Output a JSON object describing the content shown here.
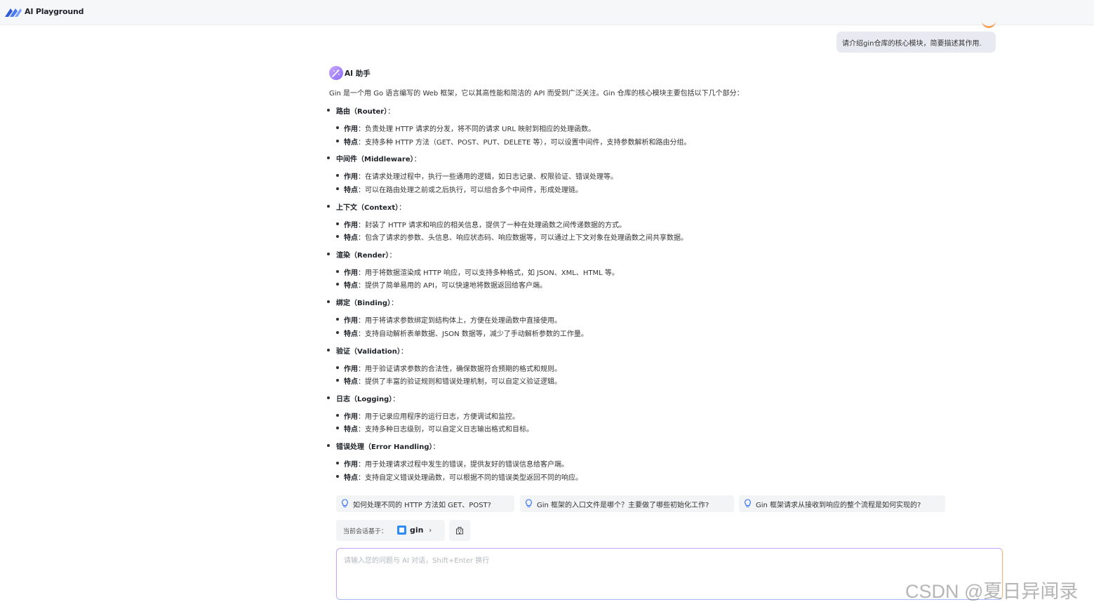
{
  "app": {
    "title": "AI Playground"
  },
  "user_message": "请介绍gin仓库的核心模块，简要描述其作用.",
  "assistant": {
    "name": "AI 助手",
    "intro": "Gin 是一个用 Go 语言编写的 Web 框架，它以其高性能和简洁的 API 而受到广泛关注。Gin 仓库的核心模块主要包括以下几个部分：",
    "sections": [
      {
        "title": "路由（Router）",
        "suffix": "：",
        "items": [
          {
            "key": "作用",
            "text": "：负责处理 HTTP 请求的分发，将不同的请求 URL 映射到相应的处理函数。"
          },
          {
            "key": "特点",
            "text": "：支持多种 HTTP 方法（GET、POST、PUT、DELETE 等），可以设置中间件，支持参数解析和路由分组。"
          }
        ]
      },
      {
        "title": "中间件（Middleware）",
        "suffix": "：",
        "items": [
          {
            "key": "作用",
            "text": "：在请求处理过程中，执行一些通用的逻辑，如日志记录、权限验证、错误处理等。"
          },
          {
            "key": "特点",
            "text": "：可以在路由处理之前或之后执行，可以组合多个中间件，形成处理链。"
          }
        ]
      },
      {
        "title": "上下文（Context）",
        "suffix": "：",
        "items": [
          {
            "key": "作用",
            "text": "：封装了 HTTP 请求和响应的相关信息，提供了一种在处理函数之间传递数据的方式。"
          },
          {
            "key": "特点",
            "text": "：包含了请求的参数、头信息、响应状态码、响应数据等，可以通过上下文对象在处理函数之间共享数据。"
          }
        ]
      },
      {
        "title": "渲染（Render）",
        "suffix": "：",
        "items": [
          {
            "key": "作用",
            "text": "：用于将数据渲染成 HTTP 响应，可以支持多种格式，如 JSON、XML、HTML 等。"
          },
          {
            "key": "特点",
            "text": "：提供了简单易用的 API，可以快速地将数据返回给客户端。"
          }
        ]
      },
      {
        "title": "绑定（Binding）",
        "suffix": "：",
        "items": [
          {
            "key": "作用",
            "text": "：用于将请求参数绑定到结构体上，方便在处理函数中直接使用。"
          },
          {
            "key": "特点",
            "text": "：支持自动解析表单数据、JSON 数据等，减少了手动解析参数的工作量。"
          }
        ]
      },
      {
        "title": "验证（Validation）",
        "suffix": "：",
        "items": [
          {
            "key": "作用",
            "text": "：用于验证请求参数的合法性，确保数据符合预期的格式和规则。"
          },
          {
            "key": "特点",
            "text": "：提供了丰富的验证规则和错误处理机制，可以自定义验证逻辑。"
          }
        ]
      },
      {
        "title": "日志（Logging）",
        "suffix": "：",
        "items": [
          {
            "key": "作用",
            "text": "：用于记录应用程序的运行日志，方便调试和监控。"
          },
          {
            "key": "特点",
            "text": "：支持多种日志级别，可以自定义日志输出格式和目标。"
          }
        ]
      },
      {
        "title": "错误处理（Error Handling）",
        "suffix": "：",
        "items": [
          {
            "key": "作用",
            "text": "：用于处理请求过程中发生的错误，提供友好的错误信息给客户端。"
          },
          {
            "key": "特点",
            "text": "：支持自定义错误处理函数，可以根据不同的错误类型返回不同的响应。"
          }
        ]
      }
    ]
  },
  "suggestions": [
    "如何处理不同的 HTTP 方法如 GET、POST?",
    "Gin 框架的入口文件是哪个？主要做了哪些初始化工作?",
    "Gin 框架请求从接收到响应的整个流程是如何实现的?"
  ],
  "context": {
    "label": "当前会话基于：",
    "repo": "gin"
  },
  "input": {
    "placeholder": "请输入您的问题与 AI 对话，Shift+Enter 换行",
    "value": ""
  },
  "watermark": "CSDN @夏日异闻录",
  "colors": {
    "accent": "#8b6cf5",
    "repo_icon": "#2f8cf5",
    "bubble": "#e7ebf1"
  },
  "icons": {
    "logo": "brand-logo-icon",
    "assistant": "assistant-avatar-icon",
    "suggestion": "lightbulb-icon",
    "repo": "repo-icon",
    "chevron": "chevron-right-icon",
    "context_button": "building-icon"
  }
}
